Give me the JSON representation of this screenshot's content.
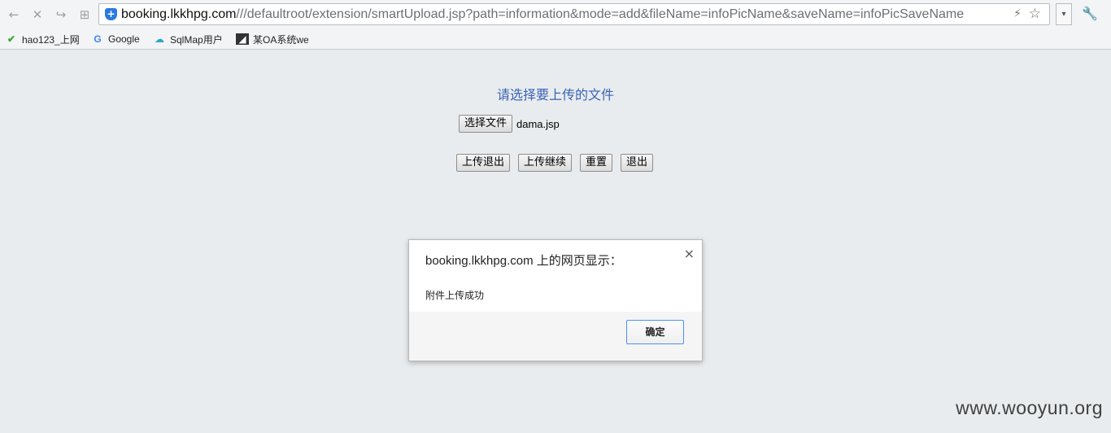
{
  "browser": {
    "nav_icons": {
      "back": "←",
      "stop": "✕",
      "forward": "↪",
      "apps": "⊞"
    },
    "url_host": "booking.lkkhpg.com",
    "url_path": "///defaultroot/extension/smartUpload.jsp?path=information&mode=add&fileName=infoPicName&saveName=infoPicSaveName",
    "dropdown_glyph": "▾",
    "bookmarks": [
      {
        "label": "hao123_上网",
        "icon": "hao-icon",
        "glyph": "✔"
      },
      {
        "label": "Google",
        "icon": "google-icon",
        "glyph": "G"
      },
      {
        "label": "SqlMap用户",
        "icon": "cloud-icon",
        "glyph": "☁"
      },
      {
        "label": "某OA系统we",
        "icon": "oa-icon",
        "glyph": "◢"
      }
    ]
  },
  "page": {
    "heading": "请选择要上传的文件",
    "choose_file_label": "选择文件",
    "file_name": "dama.jsp",
    "buttons": {
      "upload_exit": "上传退出",
      "upload_continue": "上传继续",
      "reset": "重置",
      "exit": "退出"
    }
  },
  "dialog": {
    "title": "booking.lkkhpg.com 上的网页显示：",
    "close_glyph": "×",
    "message": "附件上传成功",
    "ok_label": "确定"
  },
  "watermark": "www.wooyun.org",
  "colors": {
    "heading": "#3a63b5",
    "page_background": "#e9ecee",
    "ok_border": "#4d90fe"
  }
}
